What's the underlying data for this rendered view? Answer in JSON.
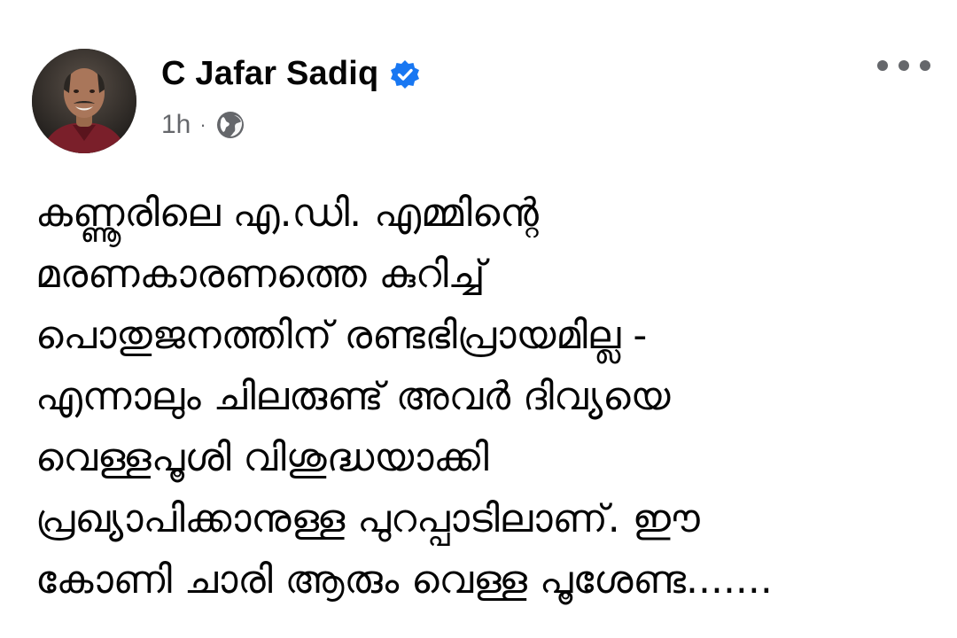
{
  "author": {
    "name": "C Jafar Sadiq",
    "verified": true,
    "verified_icon": "verified-badge-icon",
    "avatar_icon": "profile-photo"
  },
  "meta": {
    "time": "1h",
    "separator": "·",
    "audience_icon": "globe-icon"
  },
  "menu": {
    "icon": "more-options-icon"
  },
  "post": {
    "lines": [
      "കണ്ണൂരിലെ എ.ഡി. എമ്മിന്റെ",
      "മരണകാരണത്തെ കുറിച്ച്",
      "പൊതുജനത്തിന് രണ്ടഭിപ്രായമില്ല -",
      "എന്നാലും ചിലരുണ്ട് അവർ ദിവ്യയെ",
      "വെള്ളപൂശി വിശുദ്ധയാക്കി",
      "പ്രഖ്യാപിക്കാനുള്ള പുറപ്പാടിലാണ്. ഈ",
      "കോണി ചാരി ആരും വെള്ള പൂശേണ്ട......."
    ]
  },
  "colors": {
    "text_primary": "#050505",
    "text_secondary": "#65676b",
    "verified_blue": "#1877f2",
    "background": "#ffffff"
  }
}
